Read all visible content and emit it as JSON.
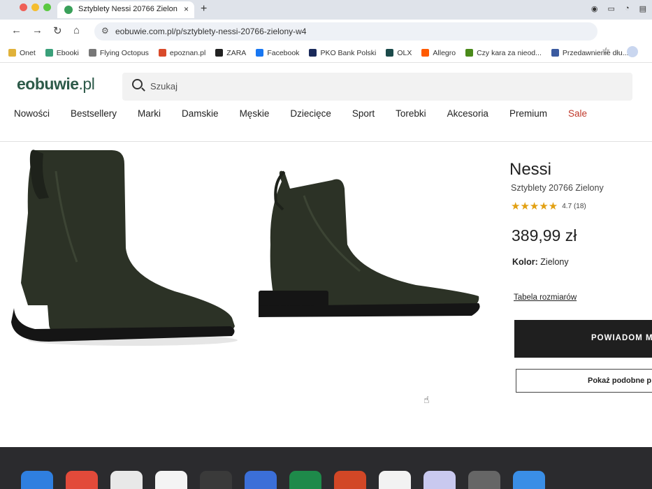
{
  "browser": {
    "tab_title": "Sztyblety Nessi 20766 Zielon",
    "tab_close": "×",
    "new_tab": "+",
    "url": "eobuwie.com.pl/p/sztyblety-nessi-20766-zielony-w4",
    "bookmarks": [
      {
        "label": "Onet",
        "color": "#e0b23a"
      },
      {
        "label": "Ebooki",
        "color": "#3aa07a"
      },
      {
        "label": "Flying Octopus",
        "color": "#777777"
      },
      {
        "label": "epoznan.pl",
        "color": "#d94a2a"
      },
      {
        "label": "ZARA",
        "color": "#222222"
      },
      {
        "label": "Facebook",
        "color": "#1877f2"
      },
      {
        "label": "PKO Bank Polski",
        "color": "#1a2a5a"
      },
      {
        "label": "OLX",
        "color": "#1b4a4a"
      },
      {
        "label": "Allegro",
        "color": "#ff5a00"
      },
      {
        "label": "Czy kara za nieod...",
        "color": "#4a8a1a"
      },
      {
        "label": "Przedawnienie dłu...",
        "color": "#3a5aa0"
      }
    ]
  },
  "site": {
    "logo_main": "eobuwie",
    "logo_suffix": ".pl",
    "search_placeholder": "Szukaj",
    "menu": [
      "Nowości",
      "Bestsellery",
      "Marki",
      "Damskie",
      "Męskie",
      "Dziecięce",
      "Sport",
      "Torebki",
      "Akcesoria",
      "Premium",
      "Sale"
    ]
  },
  "product": {
    "name": "Nessi",
    "subtitle": "Sztyblety 20766 Zielony",
    "stars": "★★★★★",
    "rating": "4.7",
    "reviews": "(18)",
    "price": "389,99 zł",
    "color_label": "Kolor:",
    "color_value": "Zielony",
    "size_table": "Tabela rozmiarów",
    "notify_button": "POWIADOM M",
    "similar_button": "Pokaż podobne p"
  },
  "colors": {
    "brand": "#2d5a49",
    "sale": "#c0392b",
    "star": "#e2a012",
    "boot": "#2c3226"
  }
}
